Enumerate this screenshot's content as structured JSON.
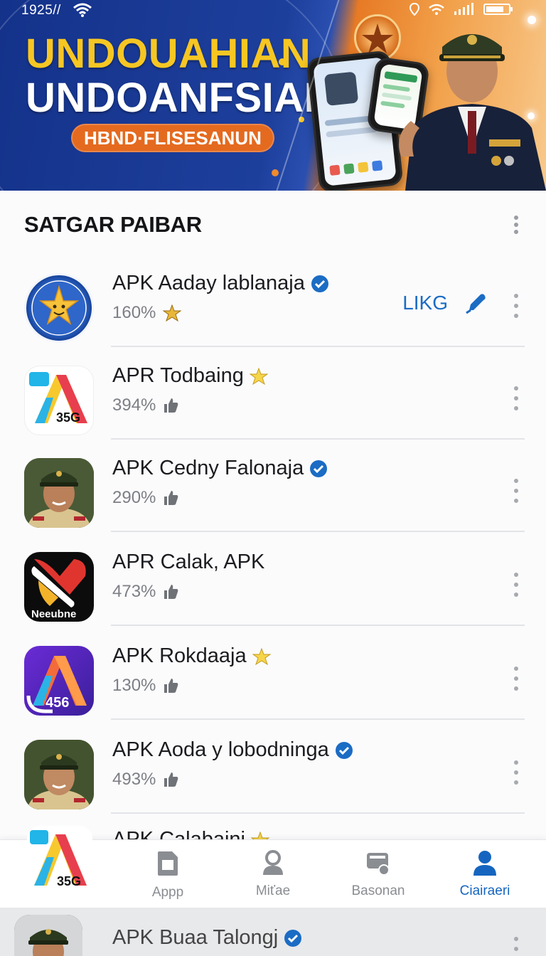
{
  "status_bar": {
    "time": "1925//"
  },
  "banner": {
    "title_line1": "UNDOUAHIAN",
    "title_line2": "UNDOANFSIAN",
    "pill": "HBND·FLISESANUN"
  },
  "section": {
    "title": "SATGAR PAIBAR"
  },
  "apps": [
    {
      "name": "APK Aaday lablanaja",
      "stat": "160%",
      "badge": "verified",
      "stat_icon": "star-icon",
      "action_label": "LIKG"
    },
    {
      "name": "APR Todbaing",
      "stat": "394%",
      "badge": "star",
      "stat_icon": "thumb-icon",
      "icon_text": "35G"
    },
    {
      "name": "APK Cedny Falonaja",
      "stat": "290%",
      "badge": "verified",
      "stat_icon": "thumb-icon"
    },
    {
      "name": "APR Calak, APK",
      "stat": "473%",
      "badge": "none",
      "stat_icon": "thumb-icon",
      "icon_text": "Neeubne"
    },
    {
      "name": "APK Rokdaaja",
      "stat": "130%",
      "badge": "star",
      "stat_icon": "thumb-icon",
      "icon_text": "456"
    },
    {
      "name": "APK Aoda y lobodninga",
      "stat": "493%",
      "badge": "verified",
      "stat_icon": "thumb-icon"
    }
  ],
  "partial_row": {
    "name": "APK Calabaini"
  },
  "nav": {
    "logo_text": "35G",
    "items": [
      {
        "label": "Appp",
        "icon": "sd-card-icon"
      },
      {
        "label": "Miťae",
        "icon": "person-icon"
      },
      {
        "label": "Basonan",
        "icon": "media-icon"
      },
      {
        "label": "Ciairaeri",
        "icon": "profile-icon",
        "active": true
      }
    ]
  },
  "peek_row": {
    "name": "APK Buaa Talongj"
  },
  "colors": {
    "accent": "#1565c0",
    "banner_blue": "#1d3f9c",
    "banner_orange": "#e77a25",
    "title_yellow": "#f6c623"
  }
}
